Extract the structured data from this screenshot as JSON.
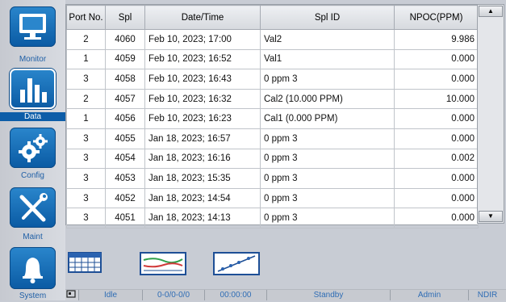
{
  "sidebar": {
    "items": [
      {
        "label": "Monitor",
        "icon": "monitor-icon"
      },
      {
        "label": "Data",
        "icon": "bar-chart-icon",
        "active": true
      },
      {
        "label": "Config",
        "icon": "gears-icon"
      },
      {
        "label": "Maint",
        "icon": "tools-icon"
      },
      {
        "label": "System",
        "icon": "bell-icon"
      }
    ]
  },
  "table": {
    "headers": [
      "Port No.",
      "Spl",
      "Date/Time",
      "Spl ID",
      "NPOC(PPM)"
    ],
    "rows": [
      [
        "2",
        "4060",
        "Feb 10, 2023; 17:00",
        "Val2",
        "9.986"
      ],
      [
        "1",
        "4059",
        "Feb 10, 2023; 16:52",
        "Val1",
        "0.000"
      ],
      [
        "3",
        "4058",
        "Feb 10, 2023; 16:43",
        "0 ppm 3",
        "0.000"
      ],
      [
        "2",
        "4057",
        "Feb 10, 2023; 16:32",
        "Cal2 (10.000 PPM)",
        "10.000"
      ],
      [
        "1",
        "4056",
        "Feb 10, 2023; 16:23",
        "Cal1 (0.000 PPM)",
        "0.000"
      ],
      [
        "3",
        "4055",
        "Jan 18, 2023; 16:57",
        "0 ppm 3",
        "0.000"
      ],
      [
        "3",
        "4054",
        "Jan 18, 2023; 16:16",
        "0 ppm 3",
        "0.002"
      ],
      [
        "3",
        "4053",
        "Jan 18, 2023; 15:35",
        "0 ppm 3",
        "0.000"
      ],
      [
        "3",
        "4052",
        "Jan 18, 2023; 14:54",
        "0 ppm 3",
        "0.000"
      ],
      [
        "3",
        "4051",
        "Jan 18, 2023; 14:13",
        "0 ppm 3",
        "0.000"
      ]
    ]
  },
  "scrollbar": {
    "up": "▲",
    "down": "▼"
  },
  "views": [
    {
      "icon": "table-view-icon"
    },
    {
      "icon": "trend-view-icon"
    },
    {
      "icon": "calibration-curve-icon"
    }
  ],
  "status": {
    "state": "Idle",
    "position": "0-0/0-0/0",
    "time": "00:00:00",
    "mode": "Standby",
    "user": "Admin",
    "detector": "NDIR"
  },
  "colors": {
    "accent": "#0d5da8",
    "status_text": "#2f6db5"
  }
}
